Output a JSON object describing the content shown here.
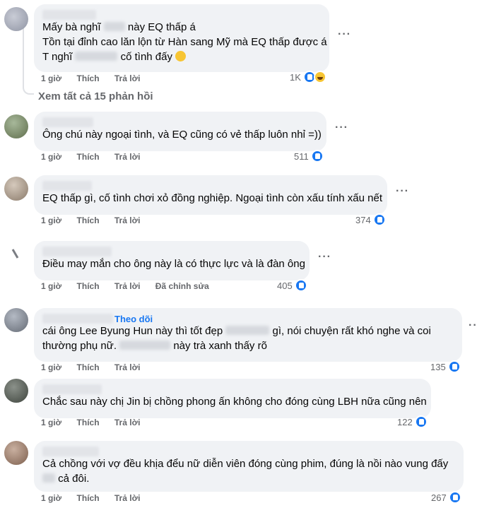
{
  "labels": {
    "like": "Thích",
    "reply": "Trả lời",
    "edited": "Đã chỉnh sửa",
    "follow": "Theo dõi",
    "more": "···"
  },
  "view_replies": "Xem tất cả 15 phản hồi",
  "colors": {
    "bubble": "#f0f2f5",
    "like": "#1877f2",
    "meta": "#65676b"
  },
  "comments": [
    {
      "time": "1 giờ",
      "reactions": "1K",
      "reaction_icons": [
        "like-icon",
        "haha-icon"
      ],
      "lines": [
        "Mấy bà nghĩ",
        "này EQ thấp á",
        "Tồn tại đỉnh cao lăn lộn từ Hàn sang Mỹ mà EQ thấp được á",
        "T nghĩ",
        "cố tình đấy"
      ],
      "emoji": "rolling-laughing-emoji"
    },
    {
      "time": "1 giờ",
      "reactions": "511",
      "text": "Ông chú này ngoại tình, và EQ cũng có vẻ thấp luôn nhỉ =))"
    },
    {
      "time": "1 giờ",
      "reactions": "374",
      "text": "EQ thấp gì, cố tình chơi xỏ đồng nghiệp. Ngoại tình còn xấu tính xấu nết"
    },
    {
      "time": "1 giờ",
      "reactions": "405",
      "text": "Điều may mắn cho ông này là có thực lực và là đàn ông"
    },
    {
      "time": "1 giờ",
      "reactions": "135",
      "parts": [
        "cái ông Lee Byung Hun này thì tốt đẹp",
        "gì, nói chuyện rất khó nghe và coi",
        "thường phụ nữ.",
        "này trà xanh thấy rõ"
      ]
    },
    {
      "time": "1 giờ",
      "reactions": "122",
      "text": "Chắc sau này chị Jin bị chồng phong ấn không cho đóng cùng LBH nữa cũng nên"
    },
    {
      "time": "1 giờ",
      "reactions": "267",
      "parts": [
        "Cả chồng với vợ đều khịa đểu nữ diễn viên đóng cùng phim, đúng là nồi nào vung đấy",
        "cả đôi."
      ]
    }
  ]
}
